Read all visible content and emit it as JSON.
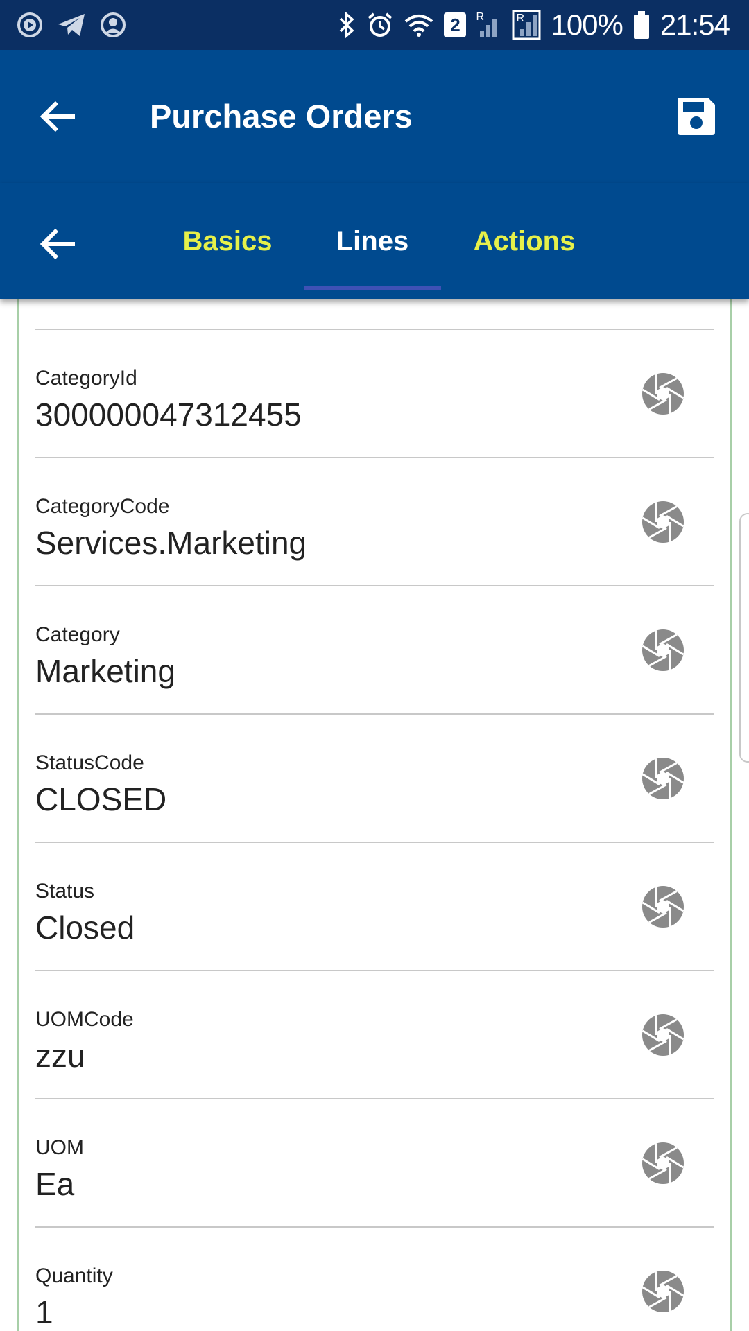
{
  "status_bar": {
    "battery": "100%",
    "time": "21:54",
    "sim_badge": "2",
    "signal_badge_1": "R",
    "signal_badge_2": "R"
  },
  "app_bar": {
    "title": "Purchase Orders"
  },
  "tabs": [
    {
      "label": "Basics"
    },
    {
      "label": "Lines"
    },
    {
      "label": "Actions"
    }
  ],
  "colors": {
    "status_bar_bg": "#0b2f63",
    "app_bar_bg": "#004a8f",
    "tab_inactive": "#e6f04a",
    "tab_active": "#ffffff",
    "tab_indicator": "#3f51b5",
    "field_icon": "#8a8a8a"
  },
  "fields": [
    {
      "label": "CategoryId",
      "value": "300000047312455",
      "icon": "shutter-icon"
    },
    {
      "label": "CategoryCode",
      "value": "Services.Marketing",
      "icon": "shutter-icon"
    },
    {
      "label": "Category",
      "value": "Marketing",
      "icon": "shutter-icon"
    },
    {
      "label": "StatusCode",
      "value": "CLOSED",
      "icon": "shutter-icon"
    },
    {
      "label": "Status",
      "value": "Closed",
      "icon": "shutter-icon"
    },
    {
      "label": "UOMCode",
      "value": "zzu",
      "icon": "shutter-icon"
    },
    {
      "label": "UOM",
      "value": "Ea",
      "icon": "shutter-icon"
    },
    {
      "label": "Quantity",
      "value": "1",
      "icon": "shutter-icon"
    }
  ]
}
